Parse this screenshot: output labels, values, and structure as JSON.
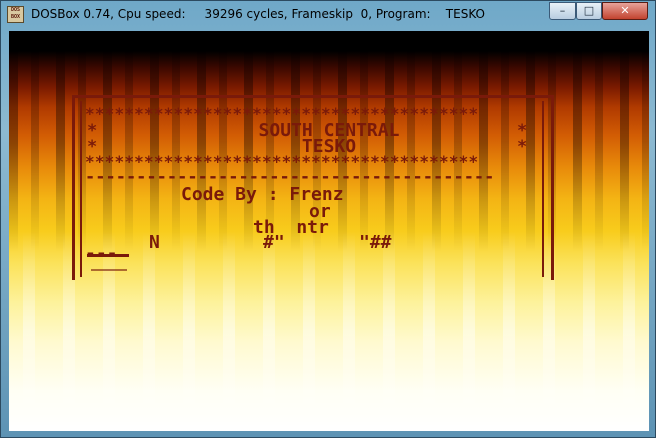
{
  "window": {
    "app_icon_text": "DOS BOX",
    "title": "DOSBox 0.74, Cpu speed:     39296 cycles, Frameskip  0, Program:    TESKO",
    "controls": {
      "minimize": "–",
      "maximize": "□",
      "close": "✕"
    }
  },
  "dos_screen": {
    "stars_top": "****************************************",
    "heading_line1_left": "*",
    "heading_line1": "SOUTH CENTRAL",
    "heading_line1_right": "*",
    "heading_line2_left": "*",
    "heading_line2": "TESKO",
    "heading_line2_right": "*",
    "stars_bottom": "****************************************",
    "dash_line": "----------------------------------------",
    "credit": "Code By : Frenz",
    "credit_cont": "or",
    "partial_1": "th  ntr",
    "partial_2": "N",
    "partial_3": "#\"",
    "partial_4": "\"##",
    "partial_5": "---"
  },
  "colors": {
    "dos_text": "#7a1a0a",
    "fire_top": "#000000",
    "fire_mid": "#f8cc1c",
    "fire_bottom": "#ffffff"
  }
}
